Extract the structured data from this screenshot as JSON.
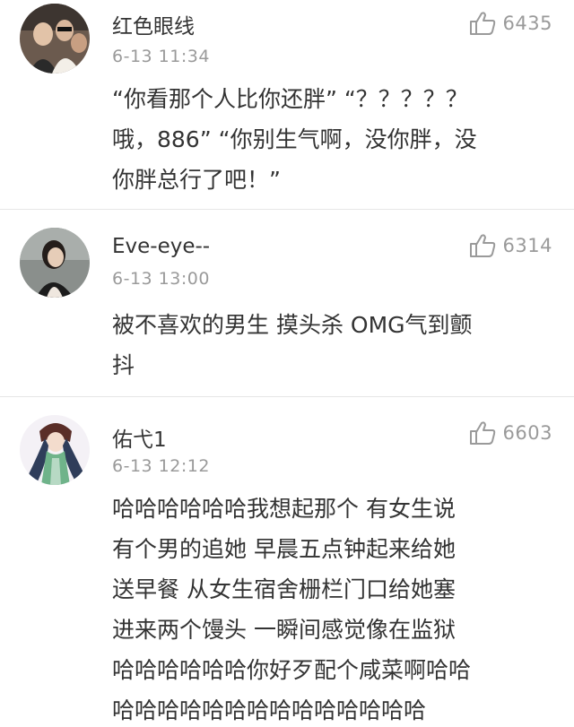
{
  "comments": [
    {
      "username": "红色眼线",
      "time": "6-13 11:34",
      "likes": "6435",
      "lines": [
        "“你看那个人比你还胖” “？？？？？",
        "哦，886” “你别生气啊，没你胖，没",
        "你胖总行了吧！”"
      ]
    },
    {
      "username": "Eve-eye--",
      "time": "6-13 13:00",
      "likes": "6314",
      "lines": [
        "被不喜欢的男生 摸头杀 OMG气到颤",
        "抖"
      ]
    },
    {
      "username": "佑弋1",
      "time": "6-13 12:12",
      "likes": "6603",
      "lines": [
        "哈哈哈哈哈哈我想起那个  有女生说",
        "有个男的追她  早晨五点钟起来给她",
        "送早餐   从女生宿舍栅栏门口给她塞",
        "进来两个馒头    一瞬间感觉像在监狱",
        "哈哈哈哈哈哈你好歹配个咸菜啊哈哈",
        "哈哈哈哈哈哈哈哈哈哈哈哈哈哈"
      ]
    }
  ]
}
